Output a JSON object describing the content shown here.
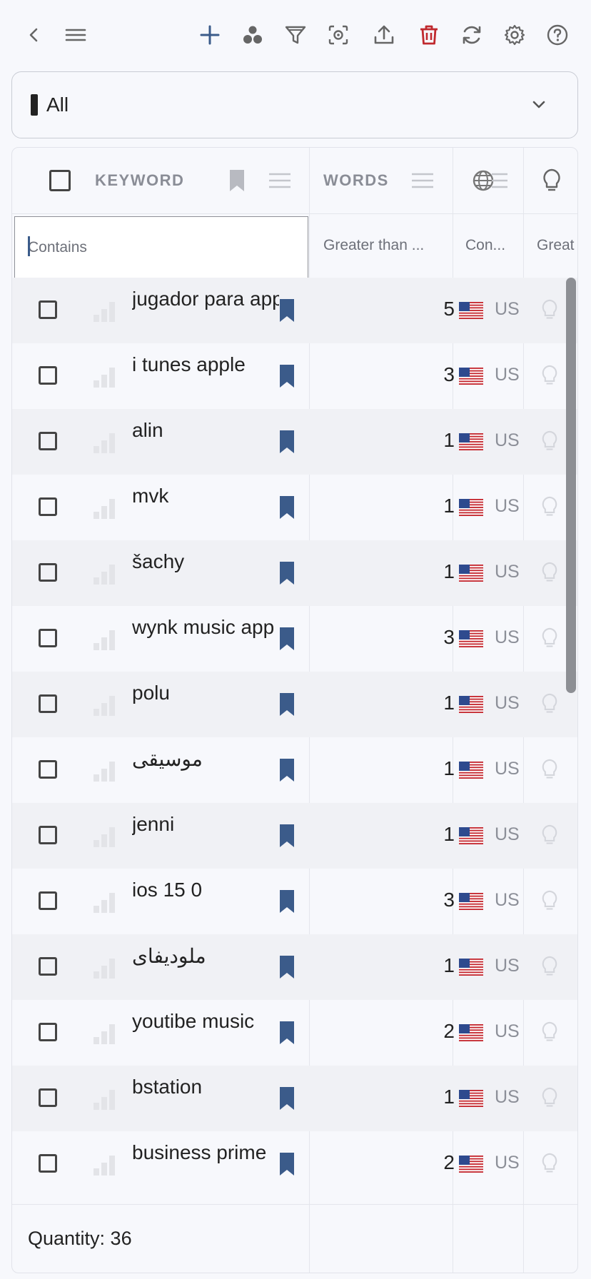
{
  "toolbar": {
    "back_icon": "chevron-left-icon",
    "menu_icon": "hamburger-icon",
    "add_icon": "plus-icon",
    "group_icon": "three-dots-cluster-icon",
    "filter_icon": "funnel-icon",
    "focus_icon": "focus-scan-icon",
    "export_icon": "upload-icon",
    "delete_icon": "trash-icon",
    "refresh_icon": "refresh-icon",
    "settings_icon": "gear-icon",
    "help_icon": "question-circle-icon",
    "accent_color": "#3b5b8a",
    "delete_color": "#c0292e"
  },
  "selector": {
    "value": "All"
  },
  "table": {
    "headers": {
      "keyword": "KEYWORD",
      "words": "WORDS"
    },
    "filters": {
      "keyword_placeholder": "Contains",
      "words": "Greater than ...",
      "country": "Con...",
      "last": "Great"
    },
    "rows": [
      {
        "keyword": "jugador para apple",
        "words": "5",
        "country": "US"
      },
      {
        "keyword": "i tunes apple",
        "words": "3",
        "country": "US"
      },
      {
        "keyword": "alin",
        "words": "1",
        "country": "US"
      },
      {
        "keyword": "mvk",
        "words": "1",
        "country": "US"
      },
      {
        "keyword": "šachy",
        "words": "1",
        "country": "US"
      },
      {
        "keyword": "wynk music app",
        "words": "3",
        "country": "US"
      },
      {
        "keyword": "polu",
        "words": "1",
        "country": "US"
      },
      {
        "keyword": "موسیقی",
        "words": "1",
        "country": "US"
      },
      {
        "keyword": "jenni",
        "words": "1",
        "country": "US"
      },
      {
        "keyword": "ios 15 0",
        "words": "3",
        "country": "US"
      },
      {
        "keyword": "ملودیفای",
        "words": "1",
        "country": "US"
      },
      {
        "keyword": "youtibe music",
        "words": "2",
        "country": "US"
      },
      {
        "keyword": "bstation",
        "words": "1",
        "country": "US"
      },
      {
        "keyword": "business prime",
        "words": "2",
        "country": "US"
      }
    ],
    "footer": {
      "quantity": "Quantity: 36"
    }
  }
}
